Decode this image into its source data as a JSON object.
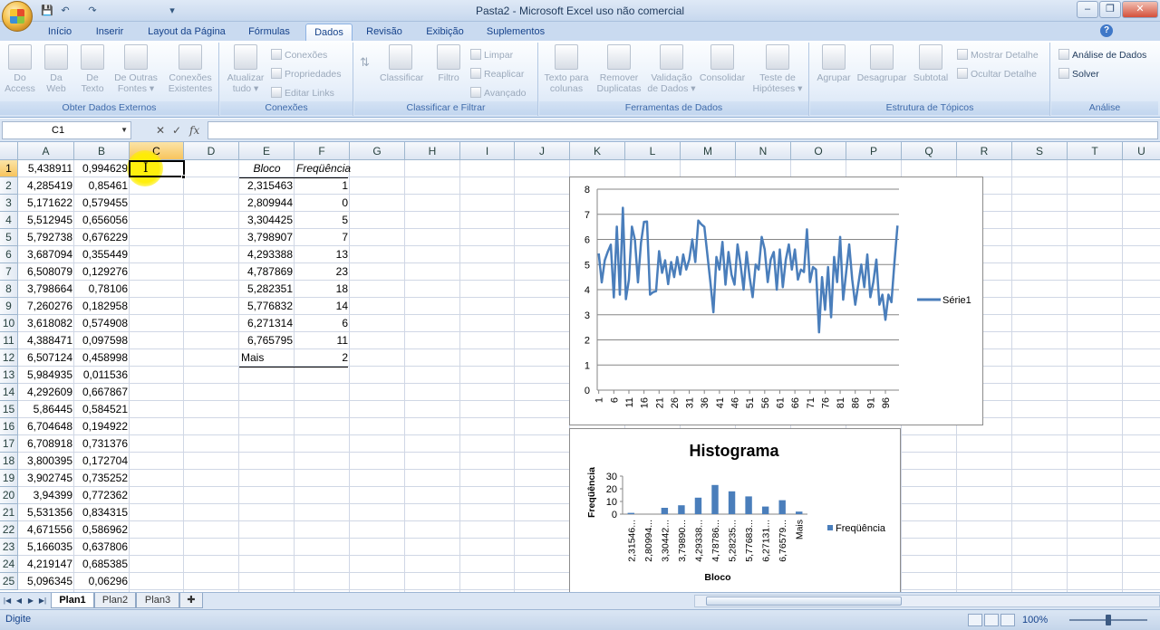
{
  "window": {
    "title": "Pasta2 - Microsoft Excel uso não comercial"
  },
  "qat": {
    "save": "💾",
    "undo": "↶",
    "redo": "↷",
    "more": "▾"
  },
  "tabs": [
    "Início",
    "Inserir",
    "Layout da Página",
    "Fórmulas",
    "Dados",
    "Revisão",
    "Exibição",
    "Suplementos"
  ],
  "active_tab": "Dados",
  "ribbon": {
    "g1": {
      "label": "Obter Dados Externos",
      "b1": "Do",
      "b1b": "Access",
      "b2": "Da",
      "b2b": "Web",
      "b3": "De",
      "b3b": "Texto",
      "b4": "De Outras",
      "b4b": "Fontes ▾",
      "b5": "Conexões",
      "b5b": "Existentes"
    },
    "g2": {
      "label": "Conexões",
      "b1": "Atualizar",
      "b1b": "tudo ▾",
      "s1": "Conexões",
      "s2": "Propriedades",
      "s3": "Editar Links"
    },
    "g3": {
      "label": "Classificar e Filtrar",
      "b1": "Classificar",
      "b2": "Filtro",
      "s1": "Limpar",
      "s2": "Reaplicar",
      "s3": "Avançado"
    },
    "g4": {
      "label": "Ferramentas de Dados",
      "b1": "Texto para",
      "b1b": "colunas",
      "b2": "Remover",
      "b2b": "Duplicatas",
      "b3": "Validação",
      "b3b": "de Dados ▾",
      "b4": "Consolidar",
      "b5": "Teste de",
      "b5b": "Hipóteses ▾"
    },
    "g5": {
      "label": "Estrutura de Tópicos",
      "b1": "Agrupar",
      "b2": "Desagrupar",
      "b3": "Subtotal",
      "s1": "Mostrar Detalhe",
      "s2": "Ocultar Detalhe"
    },
    "g6": {
      "label": "Análise",
      "s1": "Análise de Dados",
      "s2": "Solver"
    }
  },
  "formula_bar": {
    "name_box": "C1",
    "cancel": "✕",
    "enter": "✓",
    "fx": "fx",
    "formula": ""
  },
  "columns": [
    "A",
    "B",
    "C",
    "D",
    "E",
    "F",
    "G",
    "H",
    "I",
    "J",
    "K",
    "L",
    "M",
    "N",
    "O",
    "P",
    "Q",
    "R",
    "S",
    "T",
    "U"
  ],
  "rows": [
    "1",
    "2",
    "3",
    "4",
    "5",
    "6",
    "7",
    "8",
    "9",
    "10",
    "11",
    "12",
    "13",
    "14",
    "15",
    "16",
    "17",
    "18",
    "19",
    "20",
    "21",
    "22",
    "23",
    "24",
    "25"
  ],
  "col_a": [
    "5,438911",
    "4,285419",
    "5,171622",
    "5,512945",
    "5,792738",
    "3,687094",
    "6,508079",
    "3,798664",
    "7,260276",
    "3,618082",
    "4,388471",
    "6,507124",
    "5,984935",
    "4,292609",
    "5,86445",
    "6,704648",
    "6,708918",
    "3,800395",
    "3,902745",
    "3,94399",
    "5,531356",
    "4,671556",
    "5,166035",
    "4,219147",
    "5,096345"
  ],
  "col_b": [
    "0,994629",
    "0,85461",
    "0,579455",
    "0,656056",
    "0,676229",
    "0,355449",
    "0,129276",
    "0,78106",
    "0,182958",
    "0,574908",
    "0,097598",
    "0,458998",
    "0,011536",
    "0,667867",
    "0,584521",
    "0,194922",
    "0,731376",
    "0,172704",
    "0,735252",
    "0,772362",
    "0,834315",
    "0,586962",
    "0,637806",
    "0,685385",
    "0,06296"
  ],
  "col_e": [
    "Bloco",
    "2,315463",
    "2,809944",
    "3,304425",
    "3,798907",
    "4,293388",
    "4,787869",
    "5,282351",
    "5,776832",
    "6,271314",
    "6,765795",
    "Mais"
  ],
  "col_f": [
    "Freqüência",
    "1",
    "0",
    "5",
    "7",
    "13",
    "23",
    "18",
    "14",
    "6",
    "11",
    "2"
  ],
  "line_chart": {
    "type": "line",
    "series_name": "Série1",
    "y_ticks": [
      "0",
      "1",
      "2",
      "3",
      "4",
      "5",
      "6",
      "7",
      "8"
    ],
    "ylim": [
      0,
      8
    ],
    "x_ticks": [
      "1",
      "6",
      "11",
      "16",
      "21",
      "26",
      "31",
      "36",
      "41",
      "46",
      "51",
      "56",
      "61",
      "66",
      "71",
      "76",
      "81",
      "86",
      "91",
      "96"
    ],
    "legend_pos": "right",
    "color": "#4a7ebb"
  },
  "chart_data": [
    {
      "type": "line",
      "x": [
        1,
        2,
        3,
        4,
        5,
        6,
        7,
        8,
        9,
        10,
        11,
        12,
        13,
        14,
        15,
        16,
        17,
        18,
        19,
        20,
        21,
        22,
        23,
        24,
        25,
        26,
        27,
        28,
        29,
        30,
        31,
        32,
        33,
        34,
        35,
        36,
        37,
        38,
        39,
        40,
        41,
        42,
        43,
        44,
        45,
        46,
        47,
        48,
        49,
        50,
        51,
        52,
        53,
        54,
        55,
        56,
        57,
        58,
        59,
        60,
        61,
        62,
        63,
        64,
        65,
        66,
        67,
        68,
        69,
        70,
        71,
        72,
        73,
        74,
        75,
        76,
        77,
        78,
        79,
        80,
        81,
        82,
        83,
        84,
        85,
        86,
        87,
        88,
        89,
        90,
        91,
        92,
        93,
        94,
        95,
        96,
        97,
        98,
        99,
        100
      ],
      "series": [
        {
          "name": "Série1",
          "values": [
            5.44,
            4.29,
            5.17,
            5.51,
            5.79,
            3.69,
            6.51,
            3.8,
            7.26,
            3.62,
            4.39,
            6.51,
            5.98,
            4.29,
            5.86,
            6.7,
            6.71,
            3.8,
            3.9,
            3.94,
            5.53,
            4.67,
            5.17,
            4.22,
            5.1,
            4.5,
            5.3,
            4.6,
            5.4,
            4.8,
            5.2,
            6.0,
            5.1,
            6.75,
            6.6,
            6.5,
            5.4,
            4.3,
            3.1,
            5.3,
            4.8,
            5.9,
            4.2,
            5.5,
            4.6,
            4.2,
            5.8,
            5.0,
            4.0,
            5.5,
            4.5,
            3.7,
            5.0,
            4.8,
            6.1,
            5.6,
            4.3,
            5.2,
            5.5,
            4.0,
            5.6,
            4.1,
            5.2,
            5.8,
            4.8,
            5.6,
            4.4,
            4.8,
            4.7,
            6.4,
            4.3,
            4.9,
            4.8,
            2.3,
            4.5,
            3.2,
            4.9,
            2.9,
            5.3,
            4.3,
            6.1,
            3.6,
            4.7,
            5.8,
            4.4,
            3.4,
            4.2,
            5.0,
            4.1,
            5.4,
            3.7,
            4.3,
            5.2,
            3.4,
            3.8,
            2.8,
            3.8,
            3.5,
            5.1,
            6.55
          ]
        }
      ],
      "xlabel": "",
      "ylabel": "",
      "ylim": [
        0,
        8
      ]
    },
    {
      "type": "bar",
      "title": "Histograma",
      "categories": [
        "2,31546...",
        "2,80994...",
        "3,30442...",
        "3,79890...",
        "4,29338...",
        "4,78786...",
        "5,28235...",
        "5,77683...",
        "6,27131...",
        "6,76579...",
        "Mais"
      ],
      "series": [
        {
          "name": "Freqüência",
          "values": [
            1,
            0,
            5,
            7,
            13,
            23,
            18,
            14,
            6,
            11,
            2
          ]
        }
      ],
      "xlabel": "Bloco",
      "ylabel": "Freqüência",
      "ylim": [
        0,
        30
      ],
      "y_ticks": [
        "0",
        "10",
        "20",
        "30"
      ],
      "legend_pos": "right",
      "color": "#4a7ebb"
    }
  ],
  "sheets": [
    "Plan1",
    "Plan2",
    "Plan3"
  ],
  "active_sheet": "Plan1",
  "status": {
    "mode": "Digite",
    "zoom": "100%"
  }
}
